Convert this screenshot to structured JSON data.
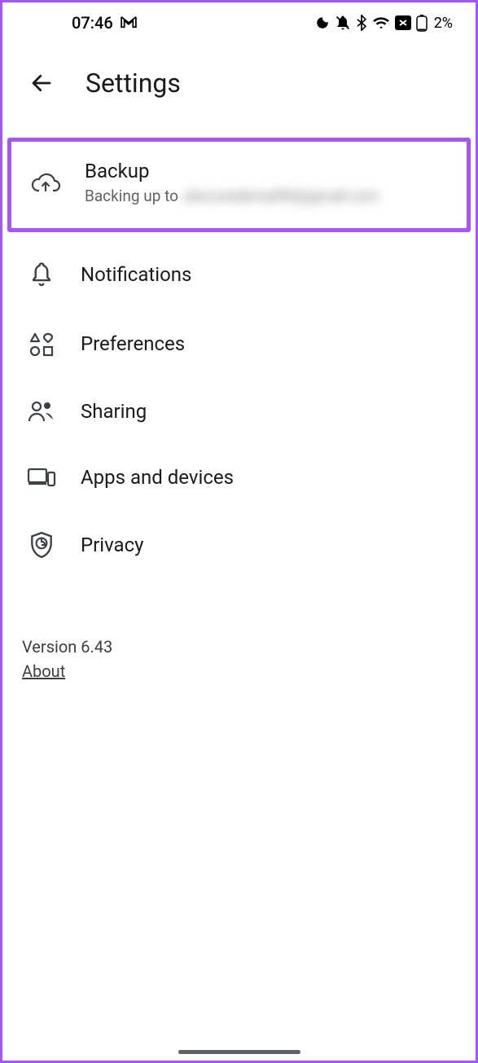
{
  "status": {
    "time": "07:46",
    "battery": "2%"
  },
  "header": {
    "title": "Settings"
  },
  "items": {
    "backup": {
      "title": "Backup",
      "subtitle_prefix": "Backing up to ",
      "subtitle_email": "obscuredemail96@gmail.com"
    },
    "notifications": {
      "title": "Notifications"
    },
    "preferences": {
      "title": "Preferences"
    },
    "sharing": {
      "title": "Sharing"
    },
    "apps": {
      "title": "Apps and devices"
    },
    "privacy": {
      "title": "Privacy"
    }
  },
  "footer": {
    "version": "Version 6.43",
    "about": "About"
  }
}
